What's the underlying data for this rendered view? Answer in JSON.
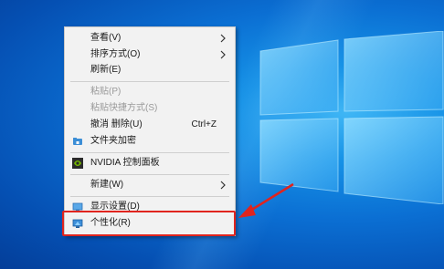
{
  "menu": {
    "view_label": "查看(V)",
    "sort_label": "排序方式(O)",
    "refresh_label": "刷新(E)",
    "paste_label": "粘贴(P)",
    "paste_shortcut_label": "粘贴快捷方式(S)",
    "undo_delete_label": "撤消 删除(U)",
    "undo_delete_shortcut": "Ctrl+Z",
    "folder_encrypt_label": "文件夹加密",
    "nvidia_label": "NVIDIA 控制面板",
    "new_label": "新建(W)",
    "display_settings_label": "显示设置(D)",
    "personalize_label": "个性化(R)"
  },
  "colors": {
    "highlight_border": "#e0241e",
    "menu_background": "#f2f2f2",
    "disabled_text": "#9a9a9a"
  },
  "icons": {
    "view_submenu": "chevron-right-icon",
    "sort_submenu": "chevron-right-icon",
    "new_submenu": "chevron-right-icon",
    "folder_encrypt": "folder-lock-icon",
    "nvidia": "nvidia-icon",
    "display_settings": "display-icon",
    "personalize": "personalize-icon"
  }
}
